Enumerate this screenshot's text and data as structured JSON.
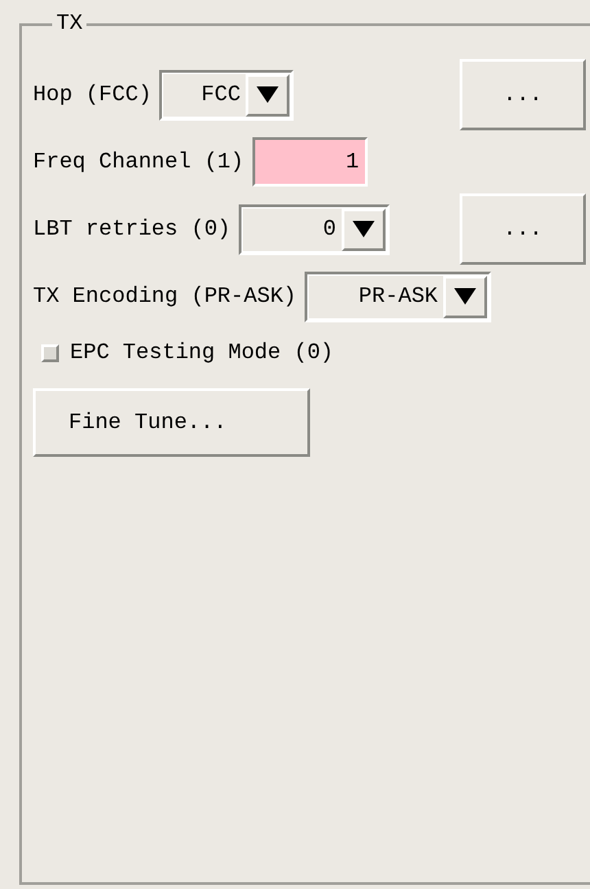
{
  "group": {
    "title": "TX"
  },
  "fields": [
    {
      "kind": "dropdown",
      "label": "Hop (FCC)",
      "value": "FCC",
      "more": "..."
    },
    {
      "kind": "entry",
      "label": "Freq Channel (1)",
      "value": "1",
      "modified": true
    },
    {
      "kind": "dropdown",
      "label": "LBT retries (0)",
      "value": "0",
      "more": "..."
    },
    {
      "kind": "dropdown",
      "label": "TX Encoding (PR-ASK)",
      "value": "PR-ASK"
    }
  ],
  "checkbox": {
    "label": "EPC Testing Mode (0)",
    "checked": false
  },
  "button": "Fine Tune..."
}
